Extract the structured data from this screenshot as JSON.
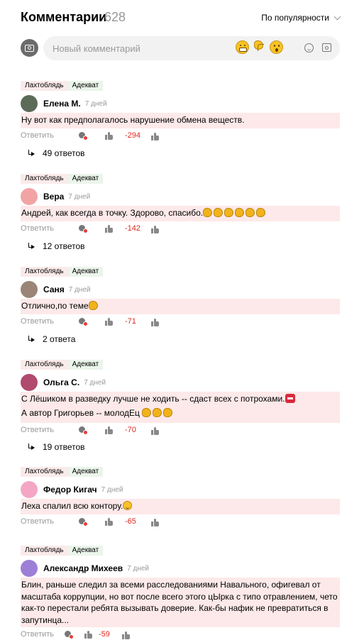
{
  "header": {
    "title": "Комментарии",
    "count": "628",
    "sort_label": "По популярности"
  },
  "new_comment": {
    "placeholder": "Новый комментарий"
  },
  "common": {
    "tag_red": "Лахтоблядь",
    "tag_green": "Адекват",
    "reply_label": "Ответить"
  },
  "comments": [
    {
      "author": "Елена М.",
      "date": "7 дней",
      "lines": [
        "Ну вот как предполагалось нарушение обмена веществ."
      ],
      "score": "-294",
      "replies": "49 ответов",
      "avatar_color": "#5c6b58"
    },
    {
      "author": "Вера",
      "date": "7 дней",
      "lines": [
        "Андрей, как всегда в точку. Здорово, спасибо."
      ],
      "score": "-142",
      "replies": "12 ответов",
      "avatar_color": "#f2a4a4"
    },
    {
      "author": "Саня",
      "date": "7 дней",
      "lines": [
        "Отлично,по теме"
      ],
      "score": "-71",
      "replies": "2 ответа",
      "avatar_color": "#9a8576"
    },
    {
      "author": "Ольга С.",
      "date": "7 дней",
      "lines": [
        "С Лёшиком в разведку лучше не ходить -- сдаст всех с потрохами.",
        "А автор Григорьев -- молодЕц"
      ],
      "score": "-70",
      "replies": "19 ответов",
      "avatar_color": "#b04a6e"
    },
    {
      "author": "Федор Кигач",
      "date": "7 дней",
      "lines": [
        "Леха спалил всю контору."
      ],
      "score": "-65",
      "avatar_color": "#f4a7c4"
    },
    {
      "author": "Александр Михеев",
      "date": "7 дней",
      "lines": [
        "Блин, раньше следил за всеми расследованиями Навального, офигевал от",
        "масштаба коррупции, но вот после всего этого цЫрка с типо отравлением, чето",
        "как-то перестали ребята вызывать доверие. Как-бы нафик не превратиться в",
        "запутинца..."
      ],
      "score": "-59",
      "avatar_color": "#9c7fd6"
    }
  ]
}
